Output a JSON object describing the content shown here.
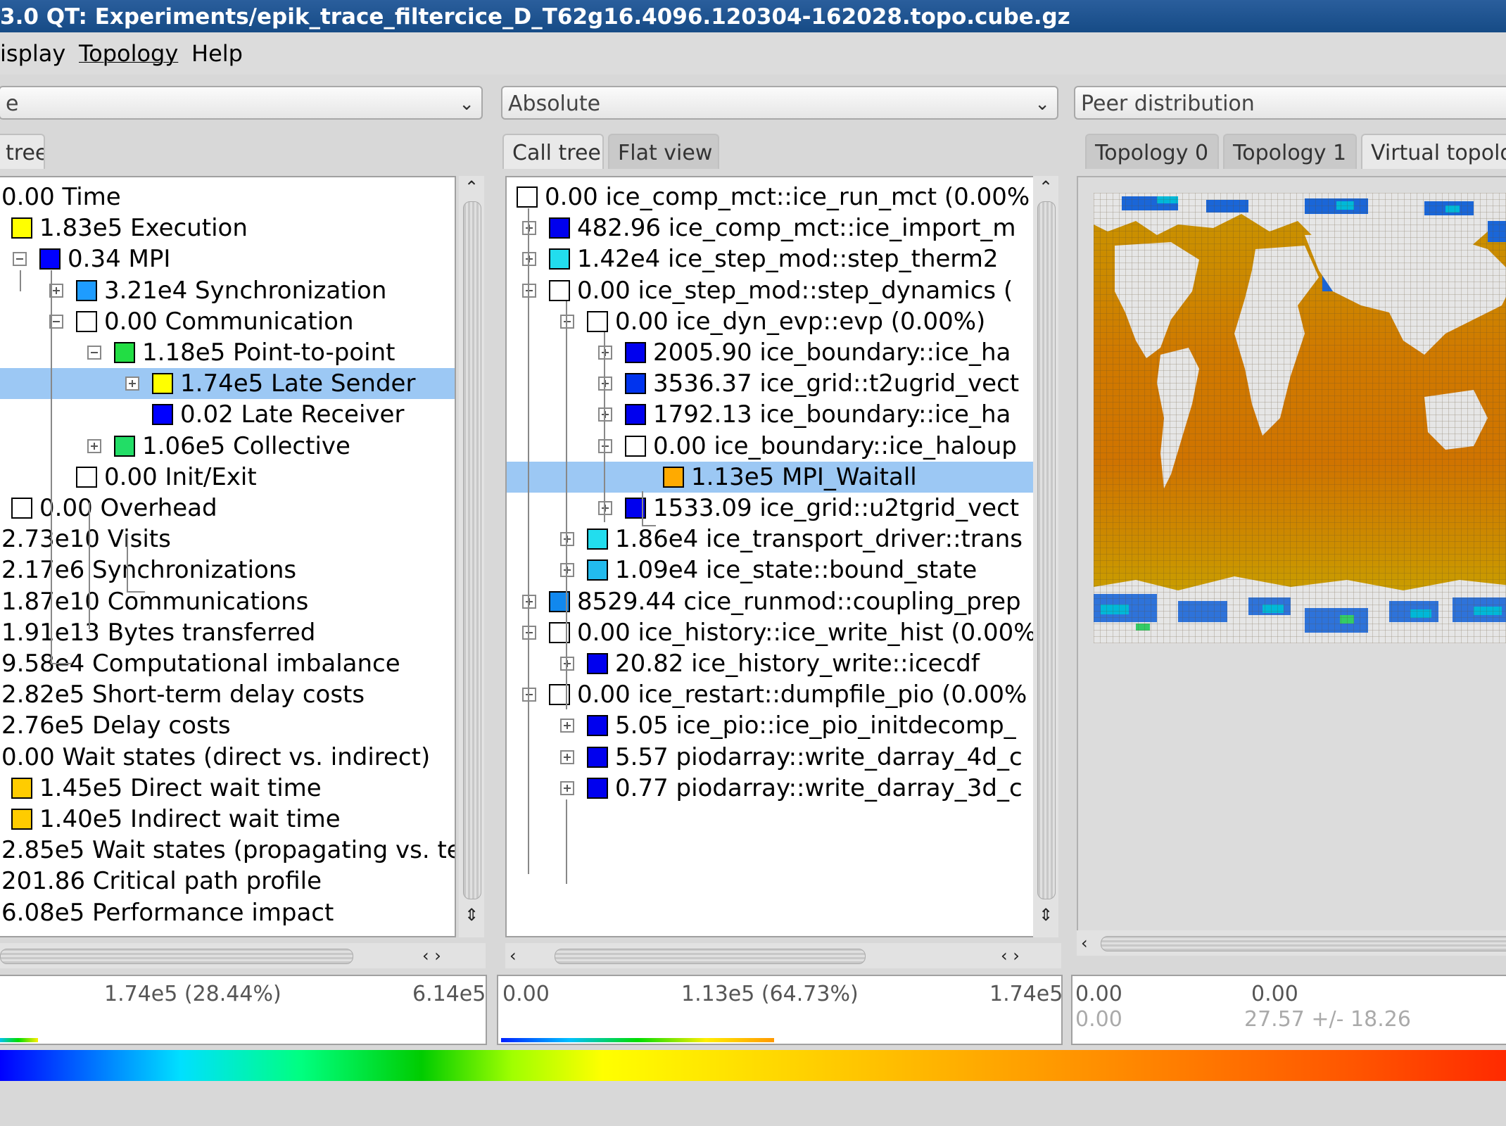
{
  "window": {
    "title": "3.0 QT: Experiments/epik_trace_filtercice_D_T62g16.4096.120304-162028.topo.cube.gz"
  },
  "menu": {
    "items": [
      "isplay",
      "Topology",
      "Help"
    ]
  },
  "combos": {
    "metric": "e",
    "calltree": "Absolute",
    "system": "Peer distribution"
  },
  "tabs": {
    "metric": [
      "tree"
    ],
    "calltree": [
      "Call tree",
      "Flat view"
    ],
    "system": [
      "Topology 0",
      "Topology 1",
      "Virtual topolog"
    ]
  },
  "metric_tree": [
    {
      "text": "0.00 Time",
      "color": null
    },
    {
      "text": "1.83e5 Execution",
      "color": "#ffff00"
    },
    {
      "text": "0.34 MPI",
      "color": "#0000ff"
    },
    {
      "text": "3.21e4 Synchronization",
      "color": "#1e9cff"
    },
    {
      "text": "0.00 Communication",
      "color": "#ffffff"
    },
    {
      "text": "1.18e5 Point-to-point",
      "color": "#22dd44"
    },
    {
      "text": "1.74e5 Late Sender",
      "color": "#ffff00"
    },
    {
      "text": "0.02 Late Receiver",
      "color": "#0000ff"
    },
    {
      "text": "1.06e5 Collective",
      "color": "#22dd66"
    },
    {
      "text": "0.00 Init/Exit",
      "color": "#ffffff"
    },
    {
      "text": "0.00 Overhead",
      "color": "#ffffff"
    },
    {
      "text": "2.73e10 Visits",
      "color": null
    },
    {
      "text": "2.17e6 Synchronizations",
      "color": null
    },
    {
      "text": "1.87e10 Communications",
      "color": null
    },
    {
      "text": "1.91e13 Bytes transferred",
      "color": null
    },
    {
      "text": "9.58e4 Computational imbalance",
      "color": null
    },
    {
      "text": "2.82e5 Short-term delay costs",
      "color": null
    },
    {
      "text": "2.76e5 Delay costs",
      "color": null
    },
    {
      "text": "0.00 Wait states (direct vs. indirect)",
      "color": null
    },
    {
      "text": "1.45e5 Direct wait time",
      "color": "#ffcc00"
    },
    {
      "text": "1.40e5 Indirect wait time",
      "color": "#ffcc00"
    },
    {
      "text": "2.85e5 Wait states (propagating vs. te",
      "color": null
    },
    {
      "text": "201.86 Critical path profile",
      "color": null
    },
    {
      "text": "6.08e5 Performance impact",
      "color": null
    }
  ],
  "call_tree": [
    {
      "text": "0.00 ice_comp_mct::ice_run_mct (0.00%",
      "color": "#ffffff"
    },
    {
      "text": "482.96 ice_comp_mct::ice_import_m",
      "color": "#0000ee"
    },
    {
      "text": "1.42e4 ice_step_mod::step_therm2",
      "color": "#22ddee"
    },
    {
      "text": "0.00 ice_step_mod::step_dynamics (",
      "color": "#ffffff"
    },
    {
      "text": "0.00 ice_dyn_evp::evp (0.00%)",
      "color": "#ffffff"
    },
    {
      "text": "2005.90 ice_boundary::ice_ha",
      "color": "#0000ee"
    },
    {
      "text": "3536.37 ice_grid::t2ugrid_vect",
      "color": "#0033ee"
    },
    {
      "text": "1792.13 ice_boundary::ice_ha",
      "color": "#0000ee"
    },
    {
      "text": "0.00 ice_boundary::ice_haloup",
      "color": "#ffffff"
    },
    {
      "text": "1.13e5 MPI_Waitall",
      "color": "#ffaa00"
    },
    {
      "text": "1533.09 ice_grid::u2tgrid_vect",
      "color": "#0000ee"
    },
    {
      "text": "1.86e4 ice_transport_driver::trans",
      "color": "#22ddee"
    },
    {
      "text": "1.09e4 ice_state::bound_state",
      "color": "#22bbee"
    },
    {
      "text": "8529.44 cice_runmod::coupling_prep",
      "color": "#1188ee"
    },
    {
      "text": "0.00 ice_history::ice_write_hist (0.00%",
      "color": "#ffffff"
    },
    {
      "text": "20.82 ice_history_write::icecdf",
      "color": "#0000ee"
    },
    {
      "text": "0.00 ice_restart::dumpfile_pio (0.00%",
      "color": "#ffffff"
    },
    {
      "text": "5.05 ice_pio::ice_pio_initdecomp_",
      "color": "#0000ee"
    },
    {
      "text": "5.57 piodarray::write_darray_4d_c",
      "color": "#0000ee"
    },
    {
      "text": "0.77 piodarray::write_darray_3d_c",
      "color": "#0000ee"
    }
  ],
  "status": {
    "metric": {
      "selected": "1.74e5 (28.44%)",
      "max": "6.14e5",
      "fill": 0.08
    },
    "calltree": {
      "min": "0.00",
      "selected": "1.13e5 (64.73%)",
      "max": "1.74e5",
      "fill": 0.647
    },
    "system": {
      "min": "0.00",
      "value": "0.00",
      "min2": "0.00",
      "stat": "27.57 +/- 18.26"
    }
  },
  "colors": {
    "ocean_orange": "#d27a00",
    "ocean_mid": "#c9a000",
    "land": "#e8e8e8",
    "ice_blue": "#1a66d8",
    "selection": "#9cc8f4"
  }
}
